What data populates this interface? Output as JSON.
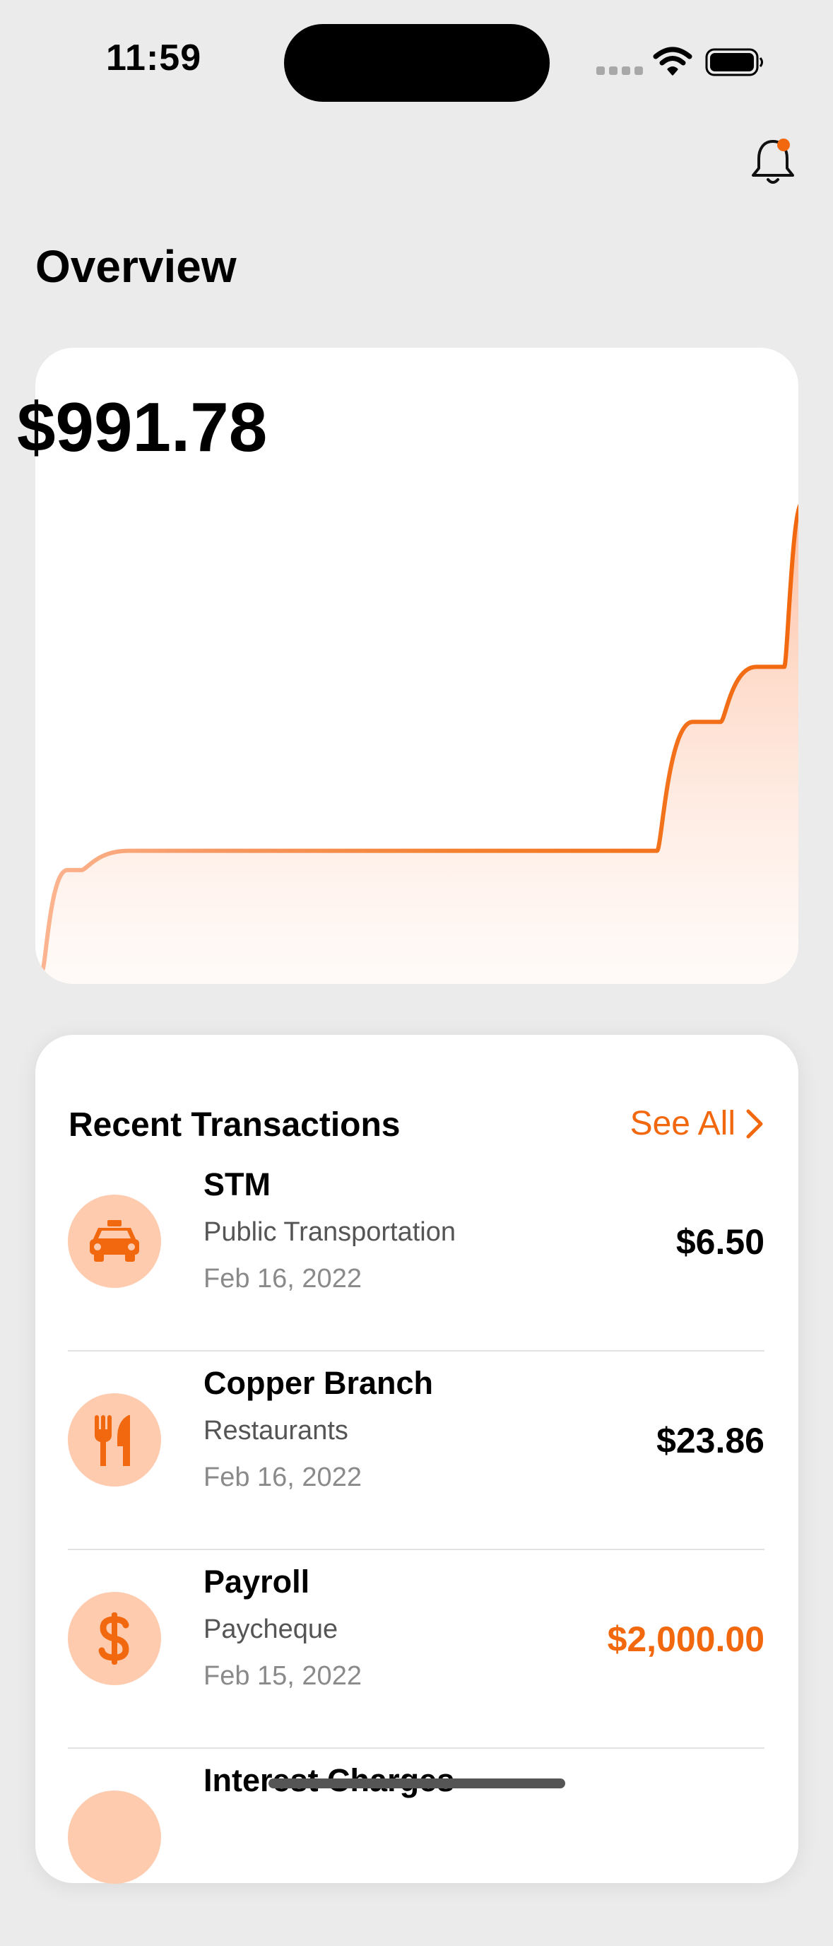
{
  "status_bar": {
    "time": "11:59"
  },
  "header": {
    "title": "Overview",
    "notification_icon": "bell-icon",
    "has_unread_badge": true
  },
  "balance": {
    "amount": "$991.78"
  },
  "chart_data": {
    "type": "area",
    "style": "step-smoothed",
    "x": [
      0,
      1,
      2,
      3,
      4,
      5,
      6
    ],
    "values": [
      0,
      212,
      253,
      253,
      527,
      644,
      991.78
    ],
    "x_axis": "none",
    "y_axis": "none",
    "grid": false,
    "legend": "none",
    "color": "#f2680f"
  },
  "recent_transactions": {
    "heading": "Recent Transactions",
    "see_all_label": "See All",
    "items": [
      {
        "name": "STM",
        "category": "Public Transportation",
        "date": "Feb 16, 2022",
        "amount": "$6.50",
        "icon": "taxi-icon",
        "income": false
      },
      {
        "name": "Copper Branch",
        "category": "Restaurants",
        "date": "Feb 16, 2022",
        "amount": "$23.86",
        "icon": "fork-knife-icon",
        "income": false
      },
      {
        "name": "Payroll",
        "category": "Paycheque",
        "date": "Feb 15, 2022",
        "amount": "$2,000.00",
        "icon": "dollar-icon",
        "income": true
      },
      {
        "name": "Interest Charges",
        "category": "",
        "date": "",
        "amount": "",
        "icon": "",
        "income": false
      }
    ]
  },
  "colors": {
    "accent": "#f2680f",
    "icon_background": "#fecbaf",
    "background": "#ebebeb",
    "card": "#ffffff"
  }
}
